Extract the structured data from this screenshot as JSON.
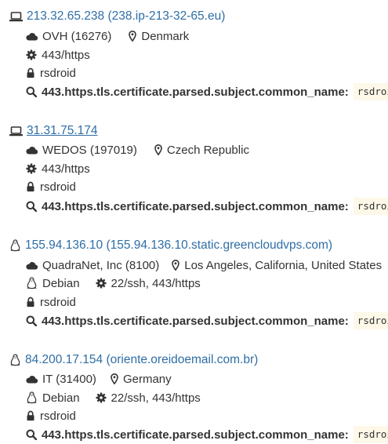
{
  "colors": {
    "link": "#2f6ea6",
    "text": "#333333",
    "code_bg": "#fdf8e8"
  },
  "query_key": "443.https.tls.certificate.parsed.subject.common_name:",
  "results": [
    {
      "os_icon": "laptop-icon",
      "ip": "213.32.65.238",
      "reverse_dns": "(238.ip-213-32-65.eu)",
      "network": "OVH (16276)",
      "location": "Denmark",
      "os": "",
      "services": "443/https",
      "tag": "rsdroid",
      "query_value": "rsdroid"
    },
    {
      "os_icon": "laptop-icon",
      "ip": "31.31.75.174",
      "reverse_dns": "",
      "network": "WEDOS (197019)",
      "location": "Czech Republic",
      "os": "",
      "services": "443/https",
      "tag": "rsdroid",
      "query_value": "rsdroid"
    },
    {
      "os_icon": "linux-penguin-icon",
      "ip": "155.94.136.10",
      "reverse_dns": "(155.94.136.10.static.greencloudvps.com)",
      "network": "QuadraNet, Inc (8100)",
      "location": "Los Angeles, California, United States",
      "os": "Debian",
      "services": "22/ssh, 443/https",
      "tag": "rsdroid",
      "query_value": "rsdroid"
    },
    {
      "os_icon": "linux-penguin-icon",
      "ip": "84.200.17.154",
      "reverse_dns": "(oriente.oreidoemail.com.br)",
      "network": "IT (31400)",
      "location": "Germany",
      "os": "Debian",
      "services": "22/ssh, 443/https",
      "tag": "rsdroid",
      "query_value": "rsdroid"
    }
  ]
}
